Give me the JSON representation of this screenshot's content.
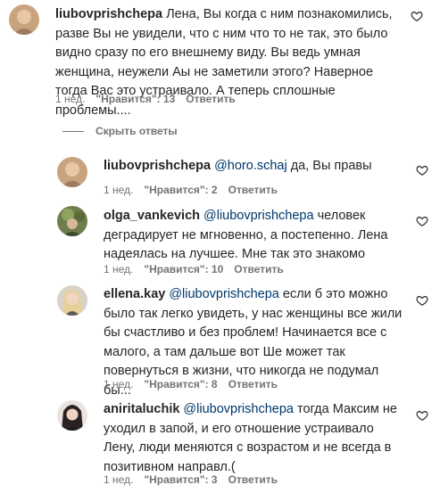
{
  "comments": [
    {
      "username": "liubovprishchepa",
      "mention": "",
      "text": "Лена, Вы когда с ним познакомились, разве Вы не увидели, что с ним что то не так, это было видно сразу по его внешнему виду. Вы ведь умная женщина, неужели Аы не заметили этого? Наверное тогда Вас это устраивало. А теперь сплошные проблемы....",
      "time": "1 нед.",
      "likes": "\"Нравится\": 13",
      "reply": "Ответить"
    },
    {
      "username": "liubovprishchepa",
      "mention": "@horo.schaj",
      "text": "да, Вы правы",
      "time": "1 нед.",
      "likes": "\"Нравится\": 2",
      "reply": "Ответить"
    },
    {
      "username": "olga_vankevich",
      "mention": "@liubovprishchepa",
      "text": "человек деградирует не мгновенно, а постепенно. Лена надеялась на лучшее. Мне так это знакомо",
      "time": "1 нед.",
      "likes": "\"Нравится\": 10",
      "reply": "Ответить"
    },
    {
      "username": "ellena.kay",
      "mention": "@liubovprishchepa",
      "text": "если б это можно было так легко увидеть, у нас женщины все жили бы счастливо и без проблем! Начинается все с малого, а там дальше вот Ше может так повернуться в жизни, что никогда не подумал бы...",
      "time": "1 нед.",
      "likes": "\"Нравится\": 8",
      "reply": "Ответить"
    },
    {
      "username": "aniritaluchik",
      "mention": "@liubovprishchepa",
      "text": "тогда Максим не уходил в запой, и его отношение устраивало Лену, люди меняются с возрастом и не всегда в позитивном направл.(",
      "time": "1 нед.",
      "likes": "\"Нравится\": 3",
      "reply": "Ответить"
    }
  ],
  "hide_replies_label": "Скрыть ответы",
  "colors": {
    "text": "#262626",
    "secondary": "#737373",
    "mention": "#00376b"
  },
  "icons": {
    "like": "heart-outline-icon"
  }
}
